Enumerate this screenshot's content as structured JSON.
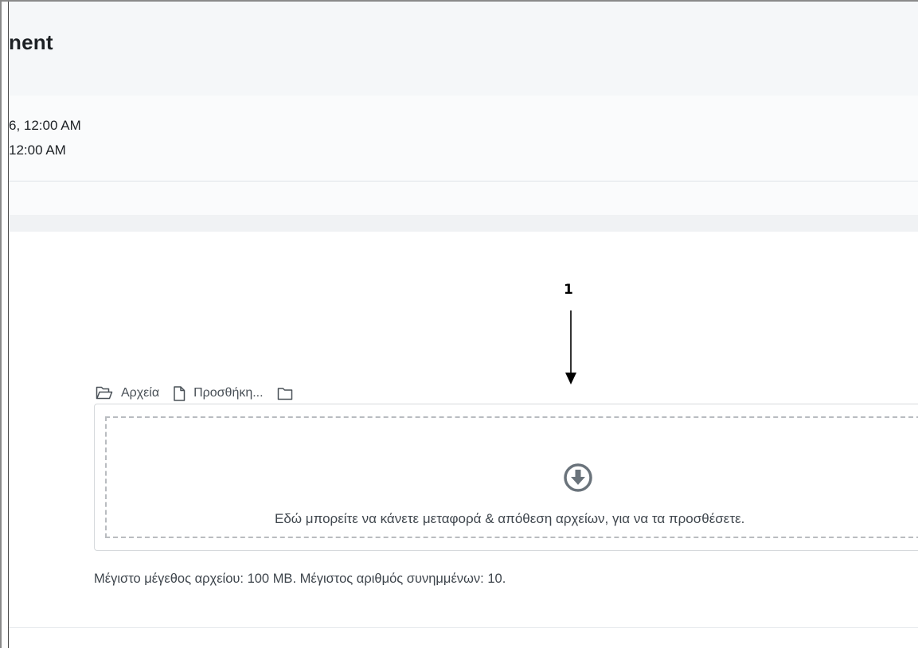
{
  "header": {
    "title": "nent"
  },
  "dates": {
    "line1": "6, 12:00 AM",
    "line2": " 12:00 AM"
  },
  "annotation": {
    "number": "1"
  },
  "filemanager": {
    "toolbar": {
      "files_label": "Αρχεία",
      "add_label": "Προσθήκη...",
      "files_icon": "folder-open-icon",
      "add_icon": "file-icon",
      "folder_icon": "folder-icon"
    },
    "dropzone": {
      "icon": "download-circle-icon",
      "message": "Εδώ μπορείτε να κάνετε μεταφορά & απόθεση αρχείων, για να τα προσθέσετε."
    },
    "limits": "Μέγιστο μέγεθος αρχείου: 100 MB. Μέγιστος αριθμός συνημμένων: 10."
  },
  "colors": {
    "header_bg": "#f5f7f9",
    "dates_bg": "#fafbfc",
    "band_bg": "#f0f2f4",
    "icon_grey": "#6a737b",
    "text": "#1d2125"
  }
}
